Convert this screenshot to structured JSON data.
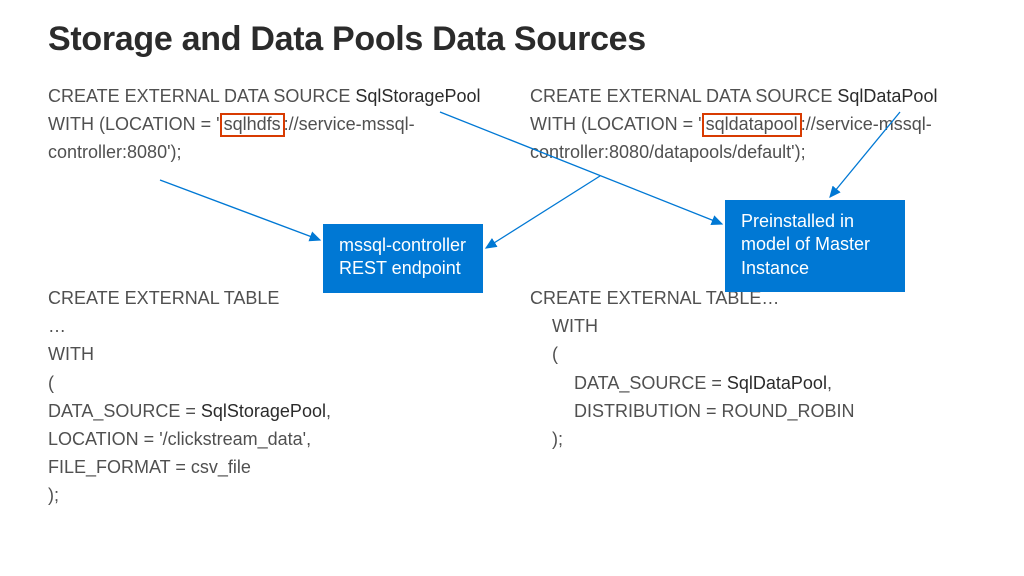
{
  "title": "Storage and Data Pools Data Sources",
  "left": {
    "l1a": "CREATE EXTERNAL DATA SOURCE ",
    "l1b": "SqlStoragePool",
    "l2a": "WITH (LOCATION = '",
    "hl": "sqlhdfs",
    "l2b": "://service-mssql-",
    "l3": "controller:8080');",
    "t1": "CREATE EXTERNAL TABLE",
    "t2": "…",
    "t3": "WITH",
    "t4": "(",
    "t5a": "DATA_SOURCE = ",
    "t5b": "SqlStoragePool",
    "t5c": ",",
    "t6": "LOCATION = '/clickstream_data',",
    "t7": "FILE_FORMAT = csv_file",
    "t8": ");"
  },
  "right": {
    "l1a": "CREATE EXTERNAL DATA SOURCE ",
    "l1b": "SqlDataPool",
    "l2a": "WITH (LOCATION = '",
    "hl": "sqldatapool",
    "l2b": "://service-mssql-",
    "l3": "controller:8080/datapools/default');",
    "t1": "CREATE EXTERNAL TABLE…",
    "t2": "WITH",
    "t3": "(",
    "t4a": "DATA_SOURCE = ",
    "t4b": "SqlDataPool",
    "t4c": ",",
    "t5": "DISTRIBUTION = ROUND_ROBIN",
    "t6": ");"
  },
  "boxes": {
    "mssql_l1": "mssql-controller",
    "mssql_l2": "REST endpoint",
    "pre_l1": "Preinstalled in",
    "pre_l2": "model of Master",
    "pre_l3": "Instance"
  },
  "accent_color": "#0078d4",
  "highlight_color": "#d83b01"
}
